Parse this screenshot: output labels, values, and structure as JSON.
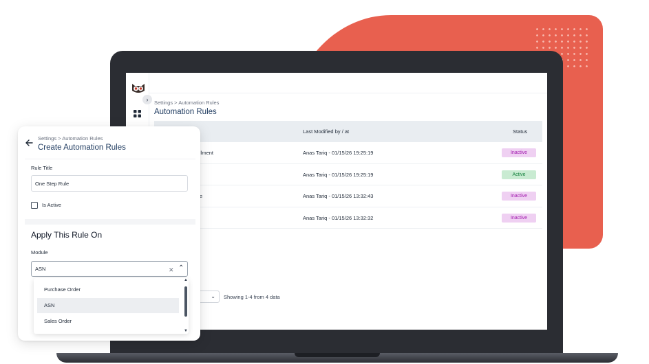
{
  "main": {
    "breadcrumb": "Settings > Automation Rules",
    "title": "Automation Rules",
    "columns": {
      "modified": "Last Modified by / at",
      "status": "Status"
    },
    "rows": [
      {
        "name_fragment": "llment",
        "modified": "Anas Tariq - 01/15/26 19:25:19",
        "status": "Inactive"
      },
      {
        "name_fragment": "",
        "modified": "Anas Tariq - 01/15/26 19:25:19",
        "status": "Active"
      },
      {
        "name_fragment": "e",
        "modified": "Anas Tariq - 01/15/26 13:32:43",
        "status": "Inactive"
      },
      {
        "name_fragment": "",
        "modified": "Anas Tariq - 01/15/26 13:32:32",
        "status": "Inactive"
      }
    ],
    "pagination_text": "Showing 1-4 from 4 data"
  },
  "card": {
    "breadcrumb": "Settings > Automation Rules",
    "title": "Create Automation Rules",
    "rule_title_label": "Rule Title",
    "rule_title_value": "One Step Rule",
    "is_active_label": "Is Active",
    "is_active_checked": false,
    "apply_section_title": "Apply This Rule On",
    "module_label": "Module",
    "module_value": "ASN",
    "module_options": [
      "Purchase Order",
      "ASN",
      "Sales Order"
    ],
    "selected_option": "ASN"
  },
  "colors": {
    "accent_blob": "#e8604f",
    "inactive_badge_bg": "#efd0f2",
    "inactive_badge_text": "#a21caf",
    "active_badge_bg": "#c9ebd2",
    "active_badge_text": "#15803d",
    "title_color": "#1e3a5f"
  },
  "icons": {
    "logo": "owl-logo-icon",
    "nav": "grid-icon",
    "collapse": "chevron-right-icon",
    "back": "arrow-left-icon",
    "clear": "close-icon",
    "dropdown": "chevron-up-icon",
    "pager": "chevron-down-icon"
  }
}
